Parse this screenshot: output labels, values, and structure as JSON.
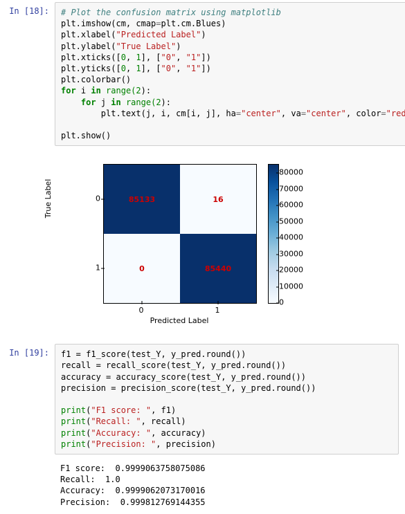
{
  "cell18": {
    "prompt": "In [18]:",
    "code": {
      "l1_comment": "# Plot the confusion matrix using matplotlib",
      "l2_a": "plt.imshow(cm, cmap",
      "l2_b": "plt.cm.Blues)",
      "l3_a": "plt.xlabel(",
      "l3_s": "\"Predicted Label\"",
      "l3_b": ")",
      "l4_a": "plt.ylabel(",
      "l4_s": "\"True Label\"",
      "l4_b": ")",
      "l5_a": "plt.xticks([",
      "l5_n0": "0",
      "l5_c": ", ",
      "l5_n1": "1",
      "l5_b": "], [",
      "l5_s0": "\"0\"",
      "l5_s1": "\"1\"",
      "l5_end": "])",
      "l6_a": "plt.yticks([",
      "l6_end": "])",
      "l7": "plt.colorbar()",
      "l8_for": "for",
      "l8_a": " i ",
      "l8_in": "in",
      "l8_rng": " range(",
      "l8_n": "2",
      "l8_b": "):",
      "l9_for": "for",
      "l9_a": " j ",
      "l9_in": "in",
      "l9_rng": " range(",
      "l9_n": "2",
      "l9_b": "):",
      "l10_a": "        plt.text(j, i, cm[i, j], ha",
      "l10_s1": "\"center\"",
      "l10_b": ", va",
      "l10_s2": "\"center\"",
      "l10_c": ", color",
      "l10_s3": "\"red\"",
      "l10_d": ")",
      "l11": "plt.show()"
    }
  },
  "chart_data": {
    "type": "heatmap",
    "title": "",
    "xlabel": "Predicted Label",
    "ylabel": "True Label",
    "xticks": [
      "0",
      "1"
    ],
    "yticks": [
      "0",
      "1"
    ],
    "matrix": [
      [
        85133,
        16
      ],
      [
        0,
        85440
      ]
    ],
    "colorbar_ticks": [
      "0",
      "10000",
      "20000",
      "30000",
      "40000",
      "50000",
      "60000",
      "70000",
      "80000"
    ],
    "colorbar_range": [
      0,
      85440
    ]
  },
  "cell19": {
    "prompt": "In [19]:",
    "code": {
      "l1": "f1 = f1_score(test_Y, y_pred.round())",
      "l2": "recall = recall_score(test_Y, y_pred.round())",
      "l3": "accuracy = accuracy_score(test_Y, y_pred.round())",
      "l4": "precision = precision_score(test_Y, y_pred.round())",
      "l5a": "print",
      "l5s": "\"F1 score: \"",
      "l5b": ", f1)",
      "l6a": "print",
      "l6s": "\"Recall: \"",
      "l6b": ", recall)",
      "l7a": "print",
      "l7s": "\"Accuracy: \"",
      "l7b": ", accuracy)",
      "l8a": "print",
      "l8s": "\"Precision: \"",
      "l8b": ", precision)"
    },
    "output": {
      "l1": "F1 score:  0.9999063758075086",
      "l2": "Recall:  1.0",
      "l3": "Accuracy:  0.9999062073170016",
      "l4": "Precision:  0.999812769144355"
    }
  }
}
